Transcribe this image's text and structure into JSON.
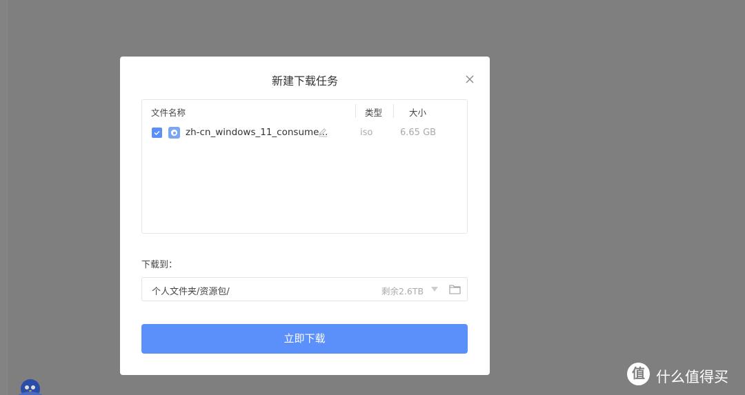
{
  "dialog": {
    "title": "新建下载任务",
    "close_icon": "close-icon"
  },
  "table": {
    "headers": {
      "name": "文件名称",
      "type": "类型",
      "size": "大小"
    },
    "files": [
      {
        "checked": true,
        "name": "zh-cn_windows_11_consume...",
        "type": "iso",
        "size": "6.65 GB"
      }
    ]
  },
  "destination": {
    "label": "下载到：",
    "path": "个人文件夹/资源包/",
    "free_space": "剩余2.6TB"
  },
  "download_button": "立即下载",
  "watermark": {
    "logo_char": "值",
    "brand": "什么值得买"
  },
  "colors": {
    "accent": "#5b8ff9",
    "overlay": "#7f7f7f"
  }
}
